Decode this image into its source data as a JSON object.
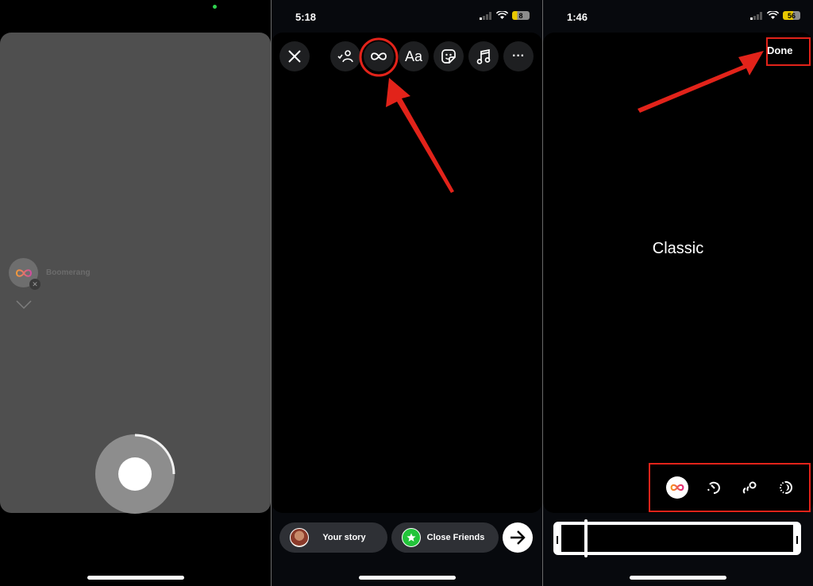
{
  "panel1": {
    "mode": {
      "label": "Boomerang",
      "icon": "infinity-icon"
    },
    "recording_progress": 0.25,
    "indicator_color": "#2fd14f"
  },
  "panel2": {
    "status": {
      "time": "5:18",
      "battery": "8"
    },
    "toolbar": [
      {
        "name": "close",
        "icon": "close-icon"
      },
      {
        "name": "tag-people",
        "icon": "tag-people-icon"
      },
      {
        "name": "boomerang",
        "icon": "infinity-icon"
      },
      {
        "name": "text",
        "icon": "text-icon",
        "label": "Aa"
      },
      {
        "name": "sticker",
        "icon": "sticker-icon"
      },
      {
        "name": "music",
        "icon": "music-icon"
      },
      {
        "name": "more",
        "icon": "more-icon",
        "label": "···"
      }
    ],
    "share": {
      "your_story": "Your story",
      "close_friends": "Close Friends",
      "close_friends_color": "#22c43a"
    }
  },
  "panel3": {
    "status": {
      "time": "1:46",
      "battery": "56"
    },
    "done_label": "Done",
    "effect_name": "Classic",
    "effects": [
      {
        "name": "classic",
        "icon": "infinity-icon",
        "selected": true
      },
      {
        "name": "slowmo",
        "icon": "slowmo-icon",
        "selected": false
      },
      {
        "name": "echo",
        "icon": "echo-icon",
        "selected": false
      },
      {
        "name": "duo",
        "icon": "duo-icon",
        "selected": false
      }
    ],
    "trim": {
      "start": 0.0,
      "end": 1.0,
      "playhead": 0.1
    }
  },
  "annotation_color": "#e2231a"
}
